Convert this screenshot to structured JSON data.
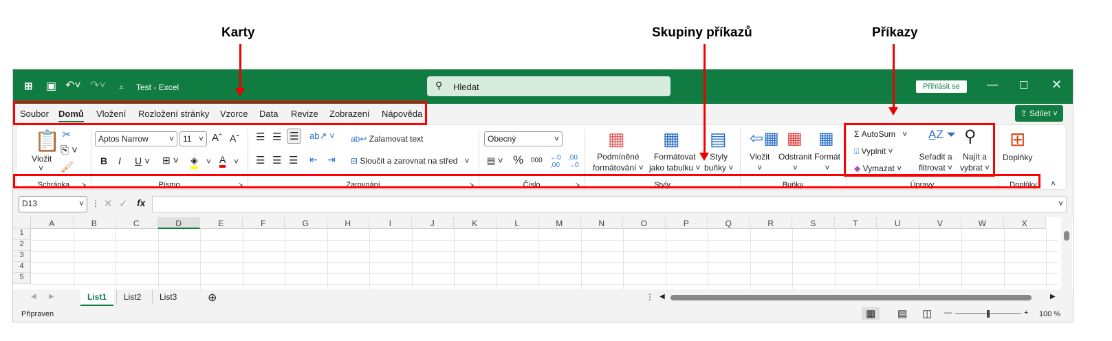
{
  "annotations": {
    "tabs": "Karty",
    "groups": "Skupiny příkazů",
    "commands": "Příkazy",
    "color": "#ff0000"
  },
  "titlebar": {
    "doc": "Test",
    "sep": "-",
    "app": "Excel",
    "search_placeholder": "Hledat",
    "signin": "Přihlásit se",
    "bg": "#107c41"
  },
  "tabs": [
    "Soubor",
    "Domů",
    "Vložení",
    "Rozložení stránky",
    "Vzorce",
    "Data",
    "Revize",
    "Zobrazení",
    "Nápověda"
  ],
  "active_tab": "Domů",
  "share": "Sdílet",
  "ribbon": {
    "paste": "Vložit",
    "font_name": "Aptos Narrow",
    "font_size": "11",
    "bold": "B",
    "italic": "I",
    "underline": "U",
    "wrap": "Zalamovat text",
    "merge": "Sloučit a zarovnat na střed",
    "number_format": "Obecný",
    "percent": "%",
    "thousands": "000",
    "cond_format": [
      "Podmíněné",
      "formátování"
    ],
    "format_table": [
      "Formátovat",
      "jako tabulku"
    ],
    "cell_styles": [
      "Styly",
      "buňky"
    ],
    "insert": "Vložit",
    "delete": "Odstranit",
    "format": "Formát",
    "autosum": "AutoSum",
    "fill": "Vyplnit",
    "clear": "Vymazat",
    "sort": [
      "Seřadit a",
      "filtrovat"
    ],
    "find": [
      "Najít a",
      "vybrat"
    ],
    "addins": "Doplňky"
  },
  "groups": [
    "Schránka",
    "Písmo",
    "Zarovnání",
    "Číslo",
    "Styly",
    "Buňky",
    "Úpravy",
    "Doplňky"
  ],
  "namebox": "D13",
  "fx": "fx",
  "columns": [
    "A",
    "B",
    "C",
    "D",
    "E",
    "F",
    "G",
    "H",
    "I",
    "J",
    "K",
    "L",
    "M",
    "N",
    "O",
    "P",
    "Q",
    "R",
    "S",
    "T",
    "U",
    "V",
    "W",
    "X"
  ],
  "rows": [
    "1",
    "2",
    "3",
    "4",
    "5"
  ],
  "sheets": [
    "List1",
    "List2",
    "List3"
  ],
  "active_sheet": "List1",
  "status": "Připraven",
  "zoom": "100 %"
}
